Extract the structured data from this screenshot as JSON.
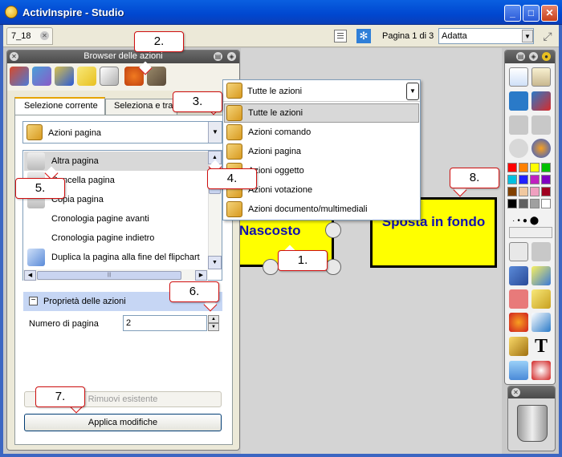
{
  "window": {
    "title": "ActivInspire - Studio",
    "min": "_",
    "max": "□",
    "close": "✕"
  },
  "topbar": {
    "doc_tab": "7_18",
    "page_counter": "Pagina 1 di 3",
    "zoom_value": "Adatta"
  },
  "browser": {
    "title": "Browser delle azioni",
    "tabs": [
      "Selezione corrente",
      "Seleziona e trascina"
    ],
    "category_value": "Azioni pagina",
    "actions": [
      "Altra pagina",
      "Cancella pagina",
      "Copia pagina",
      "Cronologia pagine avanti",
      "Cronologia pagine indietro",
      "Duplica la pagina alla fine del flipchart"
    ],
    "properties_title": "Proprietà delle azioni",
    "page_number_label": "Numero di pagina",
    "page_number_value": "2",
    "remove_button": "Rimuovi esistente",
    "apply_button": "Applica modifiche"
  },
  "popup": {
    "field_value": "Tutte le azioni",
    "options": [
      "Tutte le azioni",
      "Azioni comando",
      "Azioni pagina",
      "Azioni oggetto",
      "Azioni votazione",
      "Azioni documento/multimediali"
    ]
  },
  "canvas": {
    "box1_label": "Nascosto",
    "box2_label": "Sposta in fondo"
  },
  "callouts": [
    "1.",
    "2.",
    "3.",
    "4.",
    "5.",
    "6.",
    "7.",
    "8."
  ],
  "colors": {
    "accent": "#0047d0",
    "highlight_yellow": "#ffff00",
    "label_blue": "#1010b0",
    "callout_border": "#d01010"
  }
}
